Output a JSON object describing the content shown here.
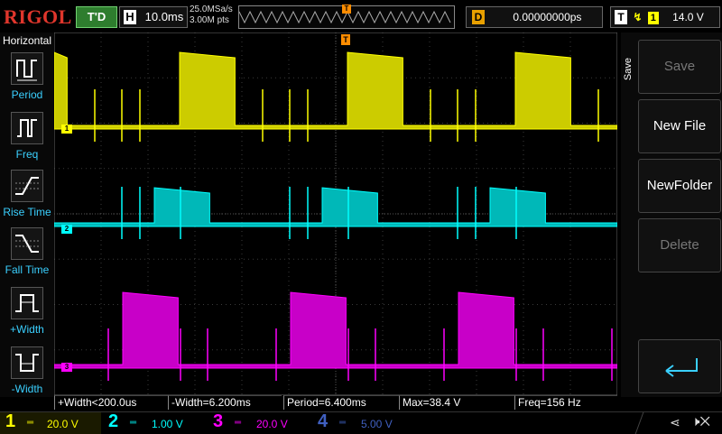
{
  "header": {
    "logo": "RIGOL",
    "trigger_status": "T'D",
    "timebase_label": "H",
    "timebase": "10.0ms",
    "sample_rate": "25.0MSa/s",
    "mem_depth": "3.00M pts",
    "trigger_pos_marker": "T",
    "delay_label": "D",
    "delay": "0.00000000ps",
    "trig_label": "T",
    "trig_channel": "1",
    "trig_level": "14.0 V"
  },
  "left_menu": {
    "title": "Horizontal",
    "items": [
      {
        "label": "Period",
        "icon": "period-icon"
      },
      {
        "label": "Freq",
        "icon": "freq-icon"
      },
      {
        "label": "Rise Time",
        "icon": "rise-time-icon"
      },
      {
        "label": "Fall Time",
        "icon": "fall-time-icon"
      },
      {
        "label": "+Width",
        "icon": "plus-width-icon"
      },
      {
        "label": "-Width",
        "icon": "minus-width-icon"
      }
    ]
  },
  "right_menu": {
    "title": "Save",
    "buttons": [
      {
        "label": "Save",
        "enabled": false
      },
      {
        "label": "New File",
        "enabled": true
      },
      {
        "label": "NewFolder",
        "enabled": true
      },
      {
        "label": "Delete",
        "enabled": false
      }
    ],
    "enter_icon": "return-arrow-icon"
  },
  "measurements": [
    {
      "text": "+Width<200.0us"
    },
    {
      "text": "-Width=6.200ms"
    },
    {
      "text": "Period=6.400ms"
    },
    {
      "text": "Max=38.4 V"
    },
    {
      "text": "Freq=156 Hz"
    }
  ],
  "channels": [
    {
      "num": "1",
      "scale": "20.0 V",
      "color": "#ffff00",
      "active": true
    },
    {
      "num": "2",
      "scale": "1.00 V",
      "color": "#00ffff",
      "active": true
    },
    {
      "num": "3",
      "scale": "20.0 V",
      "color": "#ff00ff",
      "active": true
    },
    {
      "num": "4",
      "scale": "5.00 V",
      "color": "#4060c0",
      "active": false
    }
  ],
  "status_icons": [
    "usb-icon",
    "speaker-mute-icon"
  ],
  "colors": {
    "ch1": "#ffff00",
    "ch2": "#00ffff",
    "ch3": "#ff00ff",
    "ch4": "#4060c0",
    "trigger": "#ff8c00"
  }
}
